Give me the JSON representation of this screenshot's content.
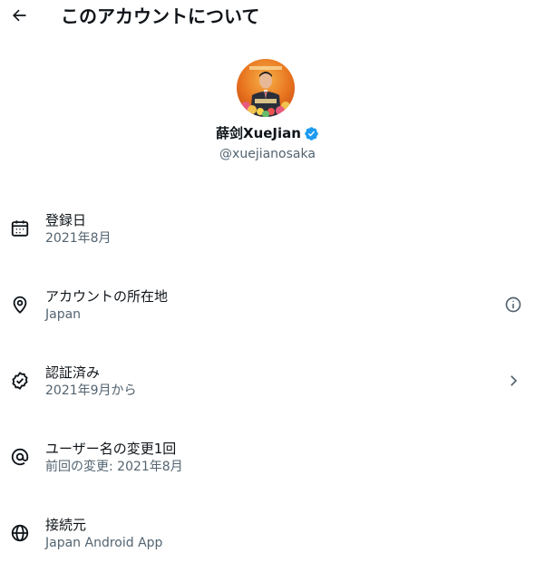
{
  "header": {
    "title": "このアカウントについて",
    "back_icon": "arrow-left-icon"
  },
  "profile": {
    "display_name": "薛剑XueJian",
    "verified": true,
    "verified_color": "#1d9bf0",
    "handle": "@xuejianosaka"
  },
  "items": [
    {
      "icon": "calendar-icon",
      "title": "登録日",
      "subtitle": "2021年8月"
    },
    {
      "icon": "location-pin-icon",
      "title": "アカウントの所在地",
      "subtitle": "Japan",
      "action_icon": "info-icon"
    },
    {
      "icon": "verified-badge-outline-icon",
      "title": "認証済み",
      "subtitle": "2021年9月から",
      "action_icon": "chevron-right-icon"
    },
    {
      "icon": "at-sign-icon",
      "title": "ユーザー名の変更1回",
      "subtitle": "前回の変更: 2021年8月"
    },
    {
      "icon": "globe-icon",
      "title": "接続元",
      "subtitle": "Japan Android App"
    }
  ],
  "colors": {
    "text_primary": "#0f1419",
    "text_secondary": "#536471"
  }
}
